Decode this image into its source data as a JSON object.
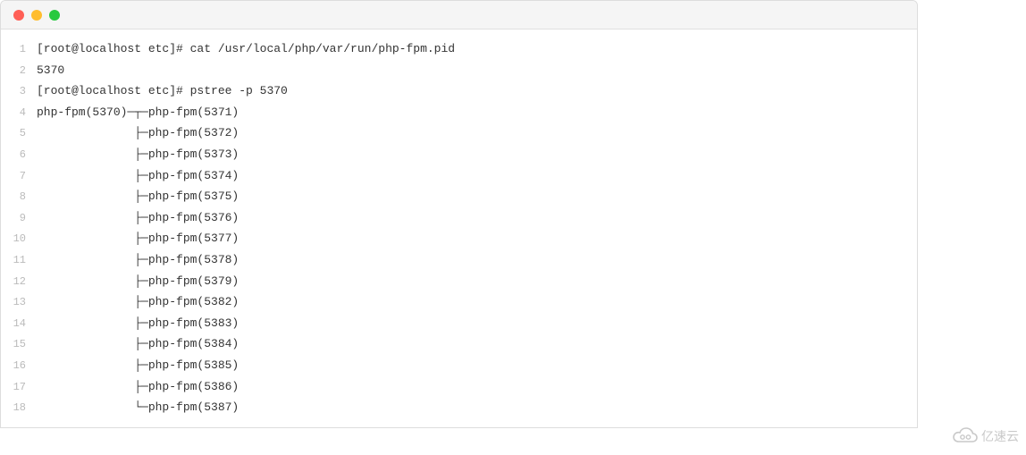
{
  "lines": [
    {
      "n": "1",
      "t": "[root@localhost etc]# cat /usr/local/php/var/run/php-fpm.pid"
    },
    {
      "n": "2",
      "t": "5370"
    },
    {
      "n": "3",
      "t": "[root@localhost etc]# pstree -p 5370"
    },
    {
      "n": "4",
      "t": "php-fpm(5370)─┬─php-fpm(5371)"
    },
    {
      "n": "5",
      "t": "              ├─php-fpm(5372)"
    },
    {
      "n": "6",
      "t": "              ├─php-fpm(5373)"
    },
    {
      "n": "7",
      "t": "              ├─php-fpm(5374)"
    },
    {
      "n": "8",
      "t": "              ├─php-fpm(5375)"
    },
    {
      "n": "9",
      "t": "              ├─php-fpm(5376)"
    },
    {
      "n": "10",
      "t": "              ├─php-fpm(5377)"
    },
    {
      "n": "11",
      "t": "              ├─php-fpm(5378)"
    },
    {
      "n": "12",
      "t": "              ├─php-fpm(5379)"
    },
    {
      "n": "13",
      "t": "              ├─php-fpm(5382)"
    },
    {
      "n": "14",
      "t": "              ├─php-fpm(5383)"
    },
    {
      "n": "15",
      "t": "              ├─php-fpm(5384)"
    },
    {
      "n": "16",
      "t": "              ├─php-fpm(5385)"
    },
    {
      "n": "17",
      "t": "              ├─php-fpm(5386)"
    },
    {
      "n": "18",
      "t": "              └─php-fpm(5387)"
    }
  ],
  "watermark": "亿速云"
}
